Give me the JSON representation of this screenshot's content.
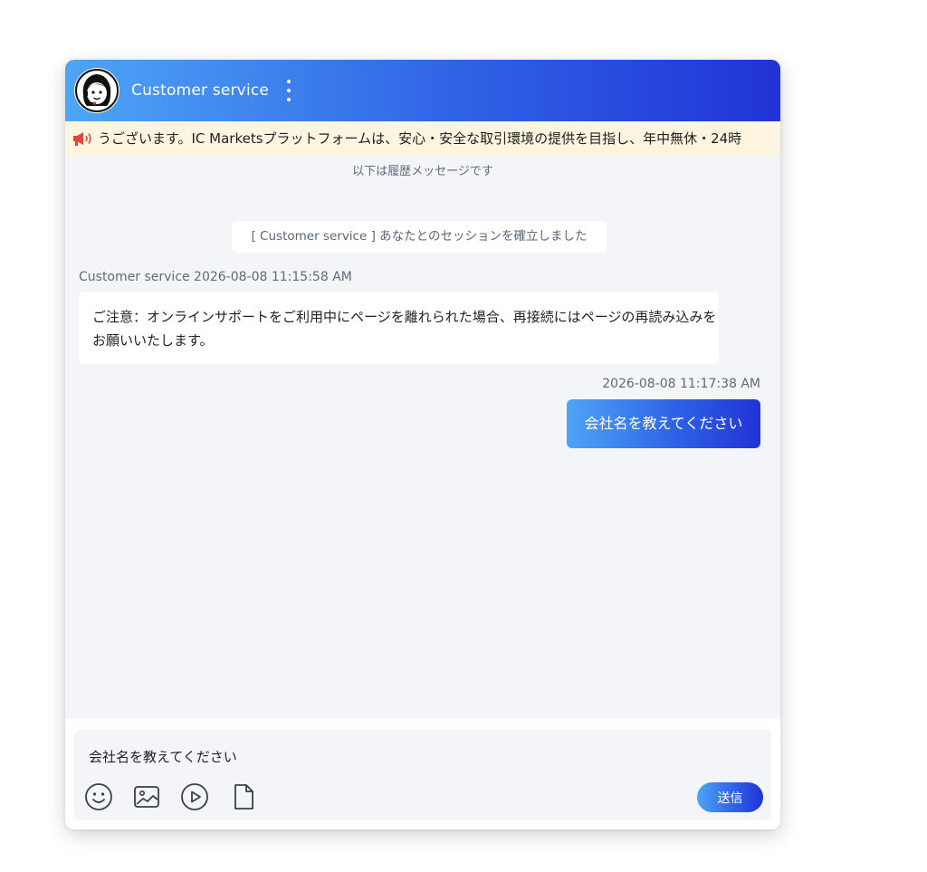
{
  "header": {
    "title": "Customer service",
    "avatar_icon": "agent-headset-avatar",
    "menu_icon": "more-vertical-icon"
  },
  "notice": {
    "icon": "megaphone-icon",
    "text": "うございます。IC Marketsプラットフォームは、安心・安全な取引環境の提供を目指し、年中無休・24時"
  },
  "messages": {
    "history_label": "以下は履歴メッセージです",
    "session_established": "[ Customer service ] あなたとのセッションを確立しました",
    "agent": {
      "meta": "Customer service 2026-08-08 11:15:58 AM",
      "text": "ご注意：オンラインサポートをご利用中にページを離れられた場合、再接続にはページの再読み込みをお願いいたします。"
    },
    "user": {
      "meta": "2026-08-08 11:17:38 AM",
      "text": "会社名を教えてください"
    }
  },
  "composer": {
    "input_value": "会社名を教えてください",
    "send_label": "送信",
    "tools": [
      "emoji-icon",
      "image-icon",
      "video-icon",
      "file-icon"
    ]
  },
  "colors": {
    "gradient_start": "#4ea5f5",
    "gradient_end": "#2233d6",
    "notice_bg": "#fdf5e0",
    "chat_bg": "#f3f5f8"
  }
}
